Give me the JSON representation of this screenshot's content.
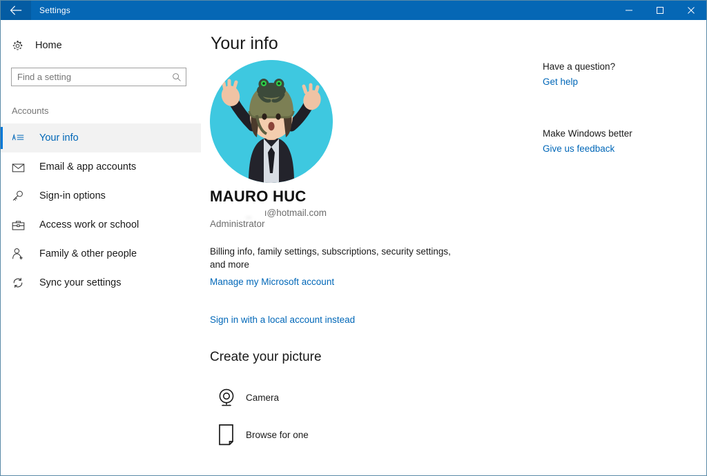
{
  "titlebar": {
    "title": "Settings",
    "back_icon": "back-arrow-icon",
    "minimize_label": "–",
    "maximize_label": "☐",
    "close_label": "✕",
    "background_color": "#0567b5"
  },
  "sidebar": {
    "home": {
      "label": "Home",
      "icon": "gear-icon"
    },
    "search": {
      "placeholder": "Find a setting",
      "value": "",
      "icon": "search-icon"
    },
    "group_label": "Accounts",
    "items": [
      {
        "label": "Your info",
        "icon": "contact-card-icon",
        "selected": true
      },
      {
        "label": "Email & app accounts",
        "icon": "envelope-icon",
        "selected": false
      },
      {
        "label": "Sign-in options",
        "icon": "key-icon",
        "selected": false
      },
      {
        "label": "Access work or school",
        "icon": "briefcase-icon",
        "selected": false
      },
      {
        "label": "Family & other people",
        "icon": "person-add-icon",
        "selected": false
      },
      {
        "label": "Sync your settings",
        "icon": "sync-icon",
        "selected": false
      }
    ],
    "accent_color": "#0078d7",
    "selected_text_color": "#0067b8"
  },
  "main": {
    "page_title": "Your info",
    "avatar": {
      "name": "user-avatar",
      "background_color": "#3ec8e0"
    },
    "account": {
      "name": "MAURO HUC",
      "email_redacted": "              _     ",
      "email_visible": "ı@hotmail.com",
      "role": "Administrator"
    },
    "billing_text": "Billing info, family settings, subscriptions, security settings, and more",
    "manage_link": "Manage my Microsoft account",
    "local_account_link": "Sign in with a local account instead",
    "create_picture_title": "Create your picture",
    "picture_options": [
      {
        "label": "Camera",
        "icon": "camera-icon"
      },
      {
        "label": "Browse for one",
        "icon": "page-icon"
      }
    ]
  },
  "help_panel": {
    "blocks": [
      {
        "heading": "Have a question?",
        "link": "Get help"
      },
      {
        "heading": "Make Windows better",
        "link": "Give us feedback"
      }
    ],
    "link_color": "#0067b8"
  }
}
